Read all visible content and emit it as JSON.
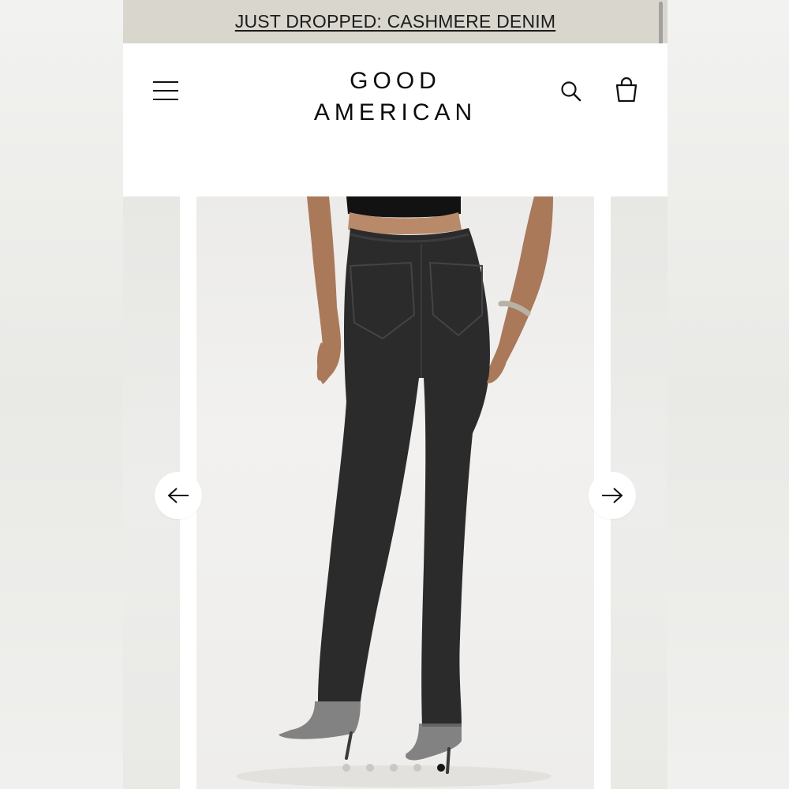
{
  "promo": {
    "text": "JUST DROPPED: CASHMERE DENIM"
  },
  "brand": {
    "line1": "GOOD",
    "line2": "AMERICAN"
  },
  "header": {
    "menu_icon": "hamburger-menu-icon",
    "search_icon": "search-icon",
    "bag_icon": "shopping-bag-icon"
  },
  "carousel": {
    "image_subject": "back view of model wearing black straight-leg jeans with clear heels",
    "prev_icon": "arrow-left-icon",
    "next_icon": "arrow-right-icon",
    "dot_count": 5,
    "active_index": 5
  },
  "colors": {
    "promo_bg": "#d9d6cd",
    "text": "#111111",
    "denim": "#2b2b2c",
    "page_bg": "#efefed"
  }
}
